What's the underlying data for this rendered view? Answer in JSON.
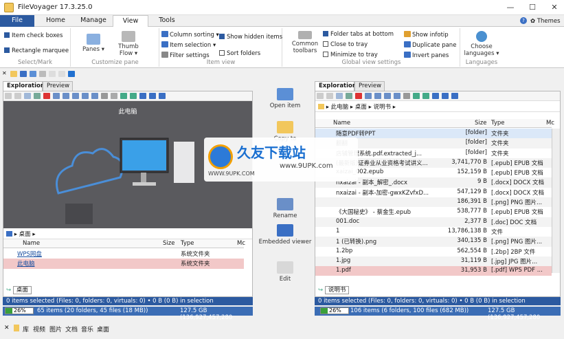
{
  "app": {
    "title": "FileVoyager 17.3.25.0",
    "themes": "Themes"
  },
  "tabs": [
    "File",
    "Home",
    "Manage",
    "View",
    "Tools"
  ],
  "ribbon": {
    "select": {
      "item_checkboxes": "Item check boxes",
      "rect_marquee": "Rectangle marquee",
      "label": "Select/Mark"
    },
    "customize": {
      "panes": "Panes",
      "thumb_flow": "Thumb Flow",
      "label": "Customize pane"
    },
    "item_view": {
      "column_sorting": "Column sorting",
      "item_selection": "Item selection",
      "filter_settings": "Filter settings",
      "show_hidden": "Show hidden items",
      "sort_folders": "Sort folders",
      "label": "Item view"
    },
    "global": {
      "common_toolbars": "Common toolbars",
      "folder_tabs": "Folder tabs at bottom",
      "close_tray": "Close to tray",
      "minimize_tray": "Minimize to tray",
      "show_infotip": "Show infotip",
      "duplicate_pane": "Duplicate pane",
      "invert_panes": "Invert panes",
      "label": "Global view settings"
    },
    "languages": {
      "choose": "Choose languages",
      "label": "Languages"
    }
  },
  "left": {
    "tabs": [
      "Exploration",
      "Preview"
    ],
    "preview_title": "此电脑",
    "path": "桌面",
    "columns": [
      "Name",
      "Size",
      "Type",
      "Mc"
    ],
    "rows": [
      {
        "name": "WPS网盘",
        "size": "",
        "type": "系统文件夹"
      },
      {
        "name": "此电脑",
        "size": "",
        "type": "系统文件夹"
      }
    ],
    "folder_tab": "桌面",
    "status": "0 items selected (Files: 0, folders: 0, virtuals: 0) • 0 B (0 B) in selection",
    "percent": "26%",
    "summary": "65 items (20 folders, 45 files (18 MB))",
    "disk": "127.5 GB (136,927,457,280"
  },
  "middle": {
    "open_item": "Open item",
    "copy_to": "Copy to",
    "rename": "Rename",
    "embedded_viewer": "Embedded viewer",
    "edit": "Edit"
  },
  "right": {
    "tabs": [
      "Exploration",
      "Preview"
    ],
    "path": [
      "此电脑",
      "桌面",
      "说明书"
    ],
    "columns": [
      "Name",
      "Size",
      "Type",
      "Mc"
    ],
    "rows": [
      {
        "name": "随意PDF转PPT",
        "size": "[folder]",
        "type": "文件夹"
      },
      {
        "name": "翻翻",
        "size": "[folder]",
        "type": "文件夹"
      },
      {
        "name": "店铺管理系统.pdf.extracted_j...",
        "size": "[folder]",
        "type": "文件夹"
      },
      {
        "name": "(最新版)证券业从业资格考试讲义...",
        "size": "3,741,770 B",
        "type": "[.epub] EPUB 文档"
      },
      {
        "name": "xaizai_002.epub",
        "size": "152,159 B",
        "type": "[.epub] EPUB 文档"
      },
      {
        "name": "nxaizai - 副本_解密_.docx",
        "size": "9 B",
        "type": "[.docx] DOCX 文档"
      },
      {
        "name": "nxaizai - 副本-加密-gwxKZvfxD...",
        "size": "547,129 B",
        "type": "[.docx] DOCX 文档"
      },
      {
        "name": "",
        "size": "186,391 B",
        "type": "[.png] PNG 图片..."
      },
      {
        "name": "《大国秘史》 - 蔡金生.epub",
        "size": "538,777 B",
        "type": "[.epub] EPUB 文档"
      },
      {
        "name": "001.doc",
        "size": "2,377 B",
        "type": "[.doc] DOC 文档"
      },
      {
        "name": "1",
        "size": "13,786,138 B",
        "type": "文件"
      },
      {
        "name": "1 (已转换).png",
        "size": "340,135 B",
        "type": "[.png] PNG 图片..."
      },
      {
        "name": "1.2bp",
        "size": "562,554 B",
        "type": "[.2bp] 2BP 文件"
      },
      {
        "name": "1.jpg",
        "size": "31,119 B",
        "type": "[.jpg] JPG 图片..."
      },
      {
        "name": "1.pdf",
        "size": "31,953 B",
        "type": "[.pdf] WPS PDF ..."
      }
    ],
    "folder_tab": "说明书",
    "status": "0 items selected (Files: 0, folders: 0, virtuals: 0) • 0 B (0 B) in selection",
    "percent": "26%",
    "summary": "106 items (6 folders, 100 files (682 MB))",
    "disk": "127.5 GB (136,927,457,280"
  },
  "watermark": {
    "main": "久友下载站",
    "url1": "WWW.9UPK.COM",
    "url2": "www.9UPK.com"
  },
  "bottom": [
    "库",
    "视频",
    "图片",
    "文档",
    "音乐",
    "桌面"
  ],
  "colors": {
    "accent": "#2c5aa0",
    "status": "#3b6db5",
    "highlight": "#f2c8c8"
  }
}
